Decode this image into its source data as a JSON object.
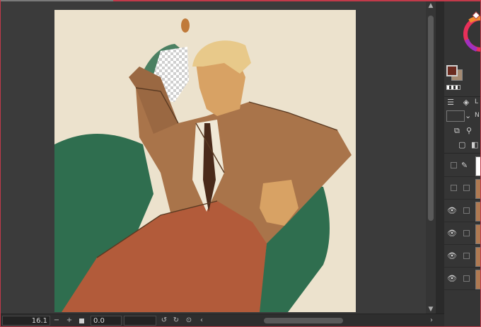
{
  "canvas": {
    "artwork": "portrait-illustration"
  },
  "bottom_bar": {
    "zoom_value": "16.1",
    "zoom_out": "−",
    "zoom_in": "+",
    "angle_value": "0.0",
    "scroll_left": "‹",
    "scroll_right": "›"
  },
  "right_panel": {
    "color_primary": "#6b2b20",
    "color_secondary": "#a58a72",
    "layer_tab_label": "L",
    "blend_label": "N",
    "layers": [
      {
        "visible": false,
        "type": "vector"
      },
      {
        "visible": false,
        "type": "raster"
      },
      {
        "visible": true,
        "type": "raster"
      },
      {
        "visible": true,
        "type": "raster"
      },
      {
        "visible": true,
        "type": "raster"
      },
      {
        "visible": true,
        "type": "raster"
      }
    ]
  },
  "colors": {
    "canvas_bg": "#3b3b3b",
    "paper": "#ece2cd",
    "green": "#2f6e4f",
    "coat": "#a9744a",
    "pants": "#b25b3a",
    "accent_frame": "#c23a4a"
  }
}
